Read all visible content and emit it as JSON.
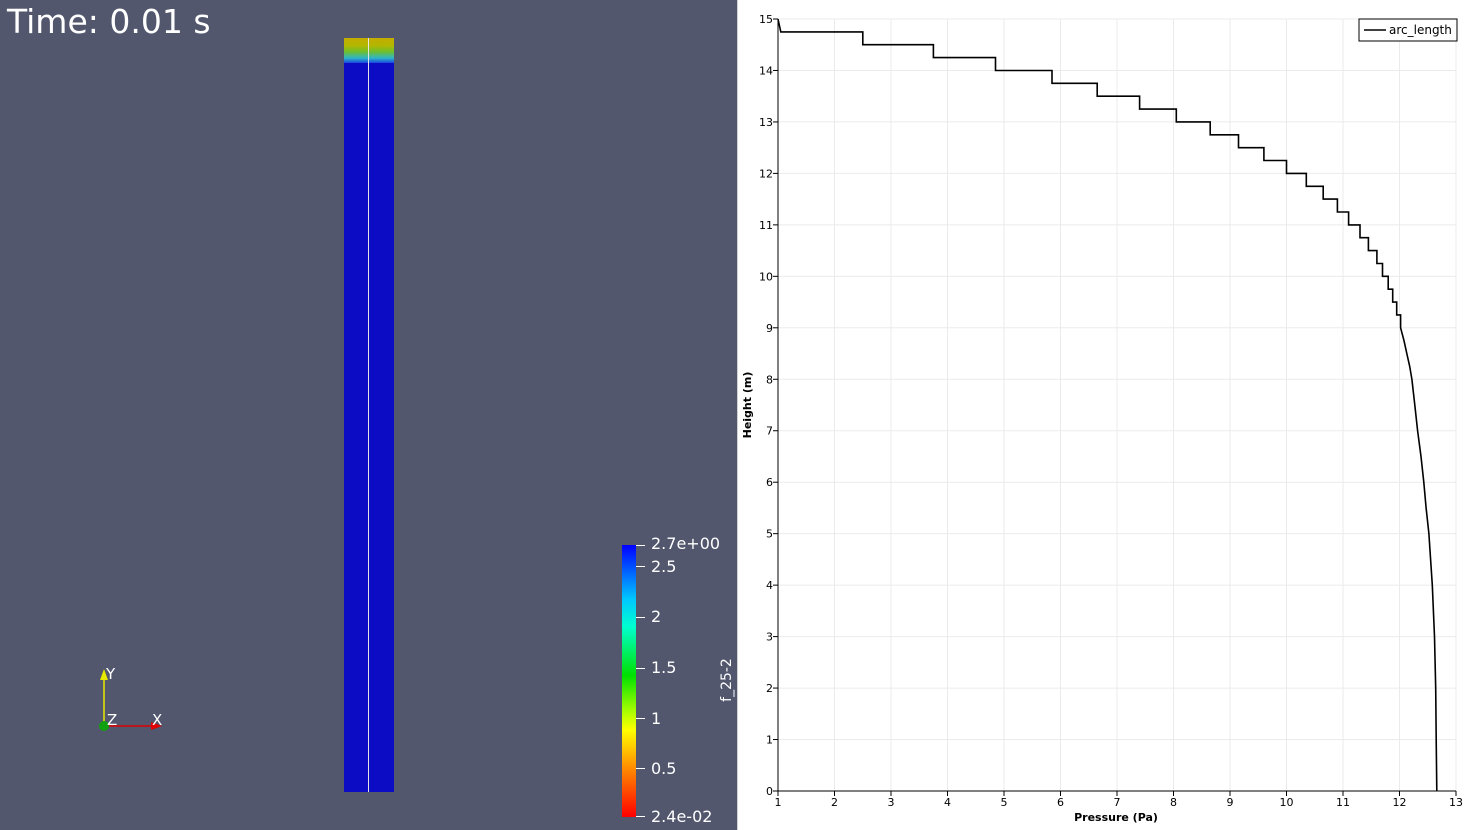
{
  "render_view": {
    "time_label": "Time: 0.01 s",
    "colorbar": {
      "title": "f_25-2",
      "max_label": "2.7e+00",
      "min_label": "2.4e-02",
      "tick_labels": [
        "2.5",
        "2",
        "1.5",
        "1",
        "0.5"
      ]
    },
    "axes": {
      "x": "X",
      "y": "Y",
      "z": "Z"
    }
  },
  "plot": {
    "legend": "arc_length",
    "xlabel": "Pressure (Pa)",
    "ylabel": "Height (m)"
  },
  "chart_data": {
    "type": "line",
    "xlabel": "Pressure (Pa)",
    "ylabel": "Height (m)",
    "xlim": [
      1,
      13
    ],
    "ylim": [
      0,
      15
    ],
    "x_ticks": [
      "1",
      "2",
      "3",
      "4",
      "5",
      "6",
      "7",
      "8",
      "9",
      "10",
      "11",
      "12",
      "13"
    ],
    "y_ticks": [
      "0",
      "1",
      "2",
      "3",
      "4",
      "5",
      "6",
      "7",
      "8",
      "9",
      "10",
      "11",
      "12",
      "13",
      "14",
      "15"
    ],
    "grid": true,
    "legend_position": "top-right",
    "series": [
      {
        "name": "arc_length",
        "color": "#000000",
        "points": [
          [
            1.0,
            15.0
          ],
          [
            1.05,
            14.75
          ],
          [
            2.5,
            14.75
          ],
          [
            2.5,
            14.5
          ],
          [
            3.75,
            14.5
          ],
          [
            3.75,
            14.25
          ],
          [
            4.85,
            14.25
          ],
          [
            4.85,
            14.0
          ],
          [
            5.85,
            14.0
          ],
          [
            5.85,
            13.75
          ],
          [
            6.65,
            13.75
          ],
          [
            6.65,
            13.5
          ],
          [
            7.4,
            13.5
          ],
          [
            7.4,
            13.25
          ],
          [
            8.05,
            13.25
          ],
          [
            8.05,
            13.0
          ],
          [
            8.65,
            13.0
          ],
          [
            8.65,
            12.75
          ],
          [
            9.15,
            12.75
          ],
          [
            9.15,
            12.5
          ],
          [
            9.6,
            12.5
          ],
          [
            9.6,
            12.25
          ],
          [
            10.0,
            12.25
          ],
          [
            10.0,
            12.0
          ],
          [
            10.35,
            12.0
          ],
          [
            10.35,
            11.75
          ],
          [
            10.65,
            11.75
          ],
          [
            10.65,
            11.5
          ],
          [
            10.9,
            11.5
          ],
          [
            10.9,
            11.25
          ],
          [
            11.1,
            11.25
          ],
          [
            11.1,
            11.0
          ],
          [
            11.3,
            11.0
          ],
          [
            11.3,
            10.75
          ],
          [
            11.45,
            10.75
          ],
          [
            11.45,
            10.5
          ],
          [
            11.6,
            10.5
          ],
          [
            11.6,
            10.25
          ],
          [
            11.7,
            10.25
          ],
          [
            11.7,
            10.0
          ],
          [
            11.8,
            10.0
          ],
          [
            11.8,
            9.75
          ],
          [
            11.88,
            9.75
          ],
          [
            11.88,
            9.5
          ],
          [
            11.95,
            9.5
          ],
          [
            11.95,
            9.25
          ],
          [
            12.02,
            9.25
          ],
          [
            12.02,
            9.0
          ],
          [
            12.08,
            8.75
          ],
          [
            12.13,
            8.5
          ],
          [
            12.18,
            8.25
          ],
          [
            12.22,
            8.0
          ],
          [
            12.27,
            7.5
          ],
          [
            12.32,
            7.0
          ],
          [
            12.38,
            6.5
          ],
          [
            12.43,
            6.0
          ],
          [
            12.47,
            5.5
          ],
          [
            12.52,
            5.0
          ],
          [
            12.55,
            4.5
          ],
          [
            12.58,
            4.0
          ],
          [
            12.62,
            3.0
          ],
          [
            12.64,
            2.0
          ],
          [
            12.65,
            1.0
          ],
          [
            12.66,
            0.0
          ]
        ]
      }
    ]
  }
}
